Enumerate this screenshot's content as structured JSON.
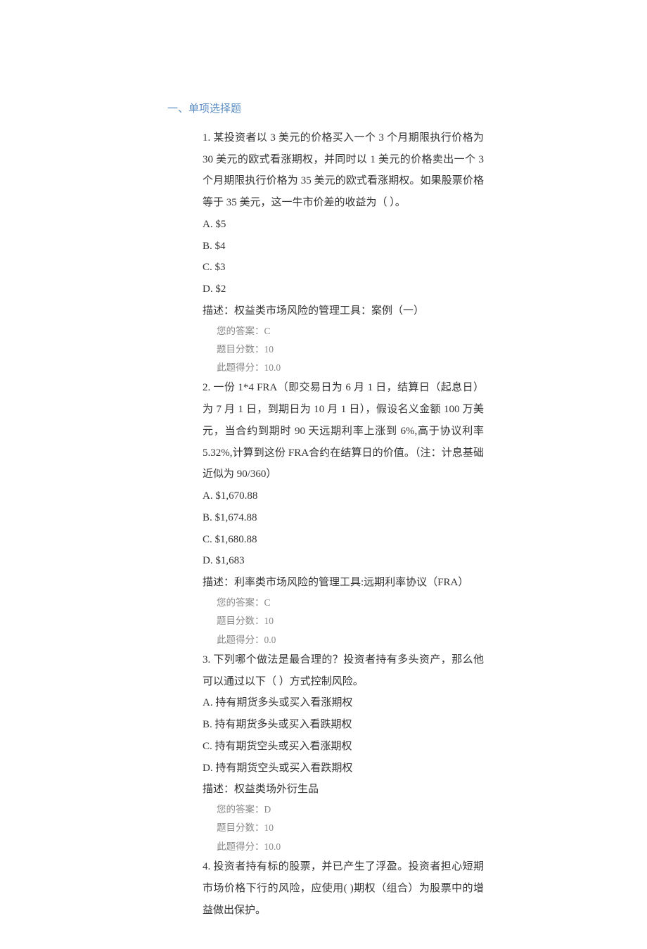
{
  "section_title": "一、单项选择题",
  "labels": {
    "your_answer": "您的答案：",
    "item_points": "题目分数：",
    "score_obtained": "此题得分："
  },
  "questions": [
    {
      "number": "1.",
      "stem": "某投资者以 3 美元的价格买入一个 3 个月期限执行价格为 30 美元的欧式看涨期权，并同时以 1 美元的价格卖出一个 3 个月期限执行价格为 35 美元的欧式看涨期权。如果股票价格等于 35 美元，这一牛市价差的收益为（ ）。",
      "options": [
        "A. $5",
        "B. $4",
        "C. $3",
        "D. $2"
      ],
      "desc": "描述：权益类市场风险的管理工具：案例（一）",
      "your_answer": "C",
      "item_points": "10",
      "score": "10.0"
    },
    {
      "number": "2.",
      "stem": "一份 1*4 FRA（即交易日为 6 月 1 日，结算日（起息日）为 7 月 1 日，到期日为 10 月 1 日），假设名义金额 100 万美元，当合约到期时 90 天远期利率上涨到 6%,高于协议利率 5.32%,计算到这份 FRA合约在结算日的价值。（注：计息基础近似为 90/360）",
      "options": [
        "A. $1,670.88",
        "B. $1,674.88",
        "C. $1,680.88",
        "D. $1,683"
      ],
      "desc": "描述：利率类市场风险的管理工具:远期利率协议（FRA）",
      "your_answer": "C",
      "item_points": "10",
      "score": "0.0"
    },
    {
      "number": "3.",
      "stem": "下列哪个做法是最合理的？投资者持有多头资产，那么他可以通过以下（ ）方式控制风险。",
      "options": [
        "A. 持有期货多头或买入看涨期权",
        "B. 持有期货多头或买入看跌期权",
        "C. 持有期货空头或买入看涨期权",
        "D. 持有期货空头或买入看跌期权"
      ],
      "desc": "描述：权益类场外衍生品",
      "your_answer": "D",
      "item_points": "10",
      "score": "10.0"
    },
    {
      "number": "4.",
      "stem": "投资者持有标的股票，并已产生了浮盈。投资者担心短期市场价格下行的风险，应使用( )期权（组合）为股票中的增益做出保护。",
      "options": [],
      "desc": "",
      "your_answer": "",
      "item_points": "",
      "score": ""
    }
  ]
}
